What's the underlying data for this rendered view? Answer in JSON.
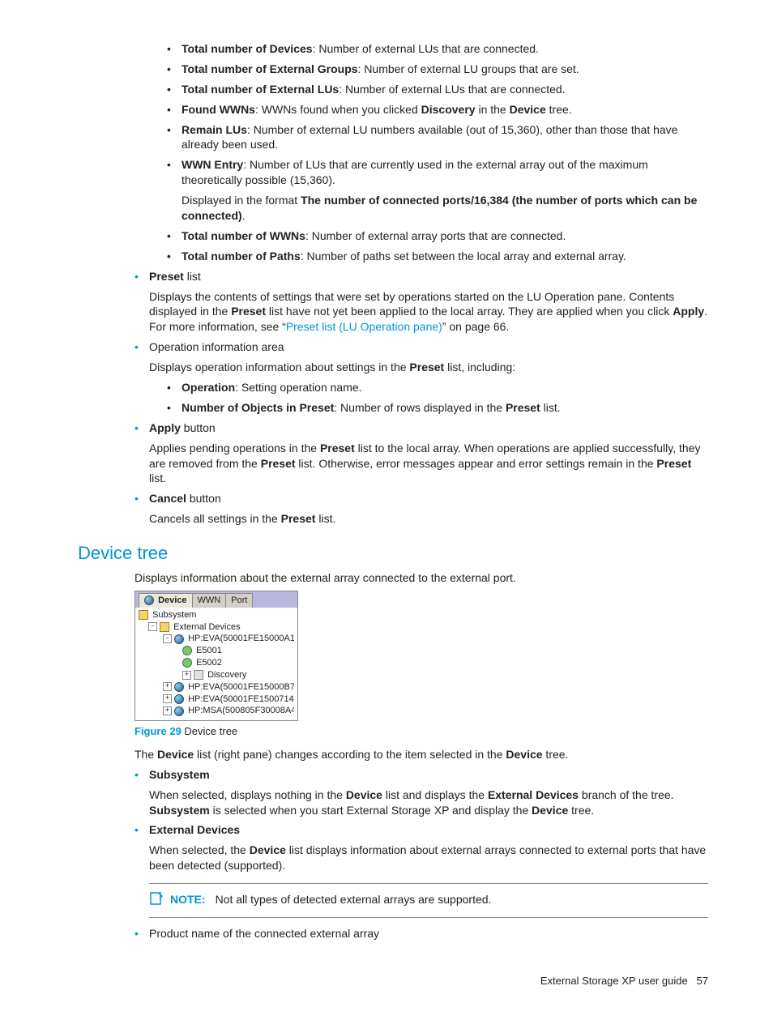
{
  "defs": {
    "totalDevices": {
      "term": "Total number of Devices",
      "desc": ": Number of external LUs that are connected."
    },
    "totalExtGroups": {
      "term": "Total number of External Groups",
      "desc": ": Number of external LU groups that are set."
    },
    "totalExtLUs": {
      "term": "Total number of External LUs",
      "desc": ": Number of external LUs that are connected."
    },
    "foundWWNs": {
      "t1": "Found WWNs",
      "t2": ": WWNs found when you clicked ",
      "t3": "Discovery",
      "t4": " in the ",
      "t5": "Device",
      "t6": " tree."
    },
    "remainLUs": {
      "term": "Remain LUs",
      "desc": ": Number of external LU numbers available (out of 15,360), other than those that have already been used."
    },
    "wwnEntry": {
      "term": "WWN Entry",
      "desc": ": Number of LUs that are currently used in the external array out of the maximum theoretically possible (15,360).",
      "disp1": "Displayed in the format ",
      "disp2": "The number of connected ports/16,384 (the number of ports which can be connected)",
      "disp3": "."
    },
    "totalWWNs": {
      "term": "Total number of WWNs",
      "desc": ": Number of external array ports that are connected."
    },
    "totalPaths": {
      "term": "Total number of Paths",
      "desc": ": Number of paths set between the local array and external array."
    }
  },
  "preset": {
    "term": "Preset",
    "listWord": " list",
    "p1a": "Displays the contents of settings that were set by operations started on the LU Operation pane. Contents displayed in the ",
    "p1b": "Preset",
    "p1c": " list have not yet been applied to the local array. They are applied when you click ",
    "p1d": "Apply",
    "p1e": ". For more information, see “",
    "link": "Preset list (LU Operation pane)",
    "p1f": "” on page 66."
  },
  "opinfo": {
    "title": "Operation information area",
    "p1a": "Displays operation information about settings in the ",
    "p1b": "Preset",
    "p1c": " list, including:",
    "op": {
      "term": "Operation",
      "desc": ": Setting operation name."
    },
    "num": {
      "t1": "Number of Objects in Preset",
      "t2": ": Number of rows displayed in the ",
      "t3": "Preset",
      "t4": " list."
    }
  },
  "apply": {
    "term": "Apply",
    "word": " button",
    "p1": "Applies pending operations in the ",
    "p2": "Preset",
    "p3": " list to the local array. When operations are applied successfully, they are removed from the ",
    "p4": "Preset",
    "p5": " list. Otherwise, error messages appear and error settings remain in the ",
    "p6": "Preset",
    "p7": " list."
  },
  "cancel": {
    "term": "Cancel",
    "word": " button",
    "p1": "Cancels all settings in the ",
    "p2": "Preset",
    "p3": " list."
  },
  "section": {
    "title": "Device tree",
    "intro": "Displays information about the external array connected to the external port."
  },
  "tree": {
    "tabs": {
      "device": "Device",
      "wwn": "WWN",
      "port": "Port"
    },
    "n0": "Subsystem",
    "n1": "External Devices",
    "n2": "HP:EVA(50001FE15000A1",
    "n3": "E5001",
    "n4": "E5002",
    "n5": "Discovery",
    "n6": "HP:EVA(50001FE15000B7",
    "n7": "HP:EVA(50001FE1500714",
    "n8": "HP:MSA(500805F30008A4"
  },
  "figcap": {
    "num": "Figure 29",
    "text": " Device tree"
  },
  "afterfig": {
    "a": "The ",
    "b": "Device",
    "c": " list (right pane) changes according to the item selected in the ",
    "d": "Device",
    "e": " tree."
  },
  "subsystem": {
    "term": "Subsystem",
    "p1": "When selected, displays nothing in the ",
    "p2": "Device",
    "p3": " list and displays the ",
    "p4": "External Devices",
    "p5": " branch of the tree. ",
    "p6": "Subsystem",
    "p7": " is selected when you start External Storage XP and display the ",
    "p8": "Device",
    "p9": " tree."
  },
  "extdev": {
    "term": "External Devices",
    "p1": "When selected, the ",
    "p2": "Device",
    "p3": " list displays information about external arrays connected to external ports that have been detected (supported)."
  },
  "note": {
    "label": "NOTE:",
    "text": "Not all types of detected external arrays are supported."
  },
  "prodname": "Product name of the connected external array",
  "footer": {
    "title": "External Storage XP user guide",
    "page": "57"
  }
}
